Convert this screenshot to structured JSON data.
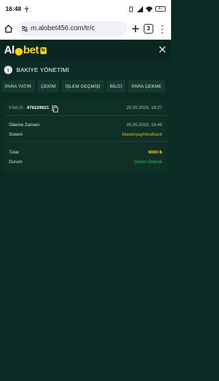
{
  "status_bar": {
    "time": "16:48",
    "battery": "47"
  },
  "browser": {
    "url": "m.alobet456.com/tr/c",
    "tab_count": "3"
  },
  "app": {
    "logo_left": "Al",
    "logo_right": "bet",
    "logo_badge": "tv"
  },
  "page": {
    "title": "BAKİYE YÖNETİMİ"
  },
  "tabs": [
    {
      "label": "PARA YATIR"
    },
    {
      "label": "ÇEKİM"
    },
    {
      "label": "İŞLEM GEÇMİŞİ"
    },
    {
      "label": "BİLGİ"
    },
    {
      "label": "PARA ÇEKME"
    }
  ],
  "transaction": {
    "id_label": "KİMLİK:",
    "id_value": "476229021",
    "created_at": "25.05.2025, 16:27",
    "payment_time_label": "Ödeme Zamanı",
    "payment_time_value": "25.05.2025, 16:46",
    "system_label": "Sistem",
    "system_value": "MasterpayNewBank",
    "amount_label": "Tutar",
    "amount_value": "9000 ₺",
    "status_label": "Durum",
    "status_value": "Çekim Ödendi"
  },
  "colors": {
    "background": "#0b2c24",
    "accent_yellow": "#ffd400",
    "system_gold": "#e0b52a",
    "status_green": "#25c24a"
  }
}
